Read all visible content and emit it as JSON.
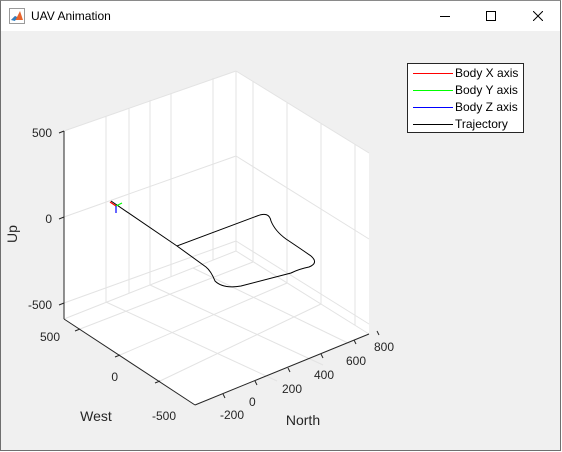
{
  "window": {
    "title": "UAV Animation",
    "app_icon": "matlab-icon",
    "controls": [
      "minimize-icon",
      "maximize-icon",
      "close-icon"
    ]
  },
  "chart_data": {
    "type": "line3d",
    "zlabel": "Up",
    "xlabel": "North",
    "ylabel": "West",
    "north_ticks": [
      "-200",
      "0",
      "200",
      "400",
      "600",
      "800"
    ],
    "west_ticks": [
      "500",
      "0",
      "-500"
    ],
    "up_ticks": [
      "500",
      "0",
      "-500"
    ],
    "xlim": [
      -300,
      900
    ],
    "ylim": [
      -600,
      600
    ],
    "zlim": [
      -600,
      600
    ],
    "grid": true,
    "legend_position": "top-right",
    "legend": [
      {
        "label": "Body X axis",
        "color": "#ff0000"
      },
      {
        "label": "Body Y axis",
        "color": "#00ff00"
      },
      {
        "label": "Body Z axis",
        "color": "#0000ff"
      },
      {
        "label": "Trajectory",
        "color": "#000000"
      }
    ]
  }
}
